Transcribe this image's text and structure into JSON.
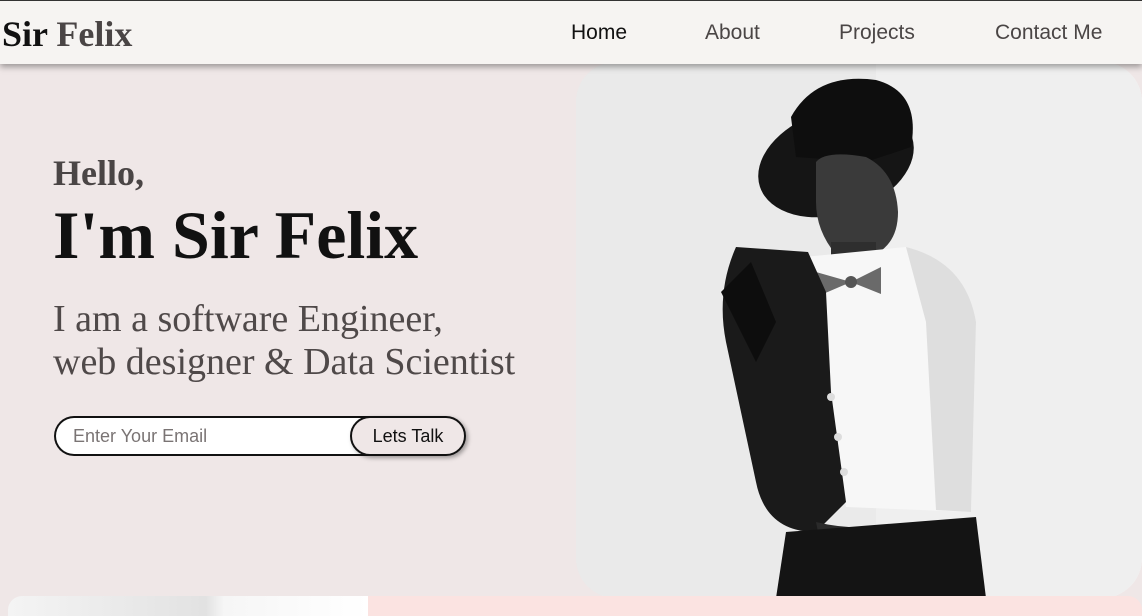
{
  "brand": {
    "first": "Sir",
    "second": "Felix"
  },
  "nav": {
    "items": [
      {
        "label": "Home",
        "active": true
      },
      {
        "label": "About",
        "active": false
      },
      {
        "label": "Projects",
        "active": false
      },
      {
        "label": "Contact Me",
        "active": false
      }
    ]
  },
  "hero": {
    "greeting": "Hello,",
    "headline": "I'm Sir Felix",
    "tagline_line1": "I am a software Engineer,",
    "tagline_line2": "web designer & Data Scientist",
    "email_placeholder": "Enter Your Email",
    "email_value": "",
    "cta_label": "Lets Talk"
  },
  "colors": {
    "background": "#efe7e7",
    "navbar": "#f6f4f2",
    "text_dark": "#111111",
    "text_muted": "#4a4545",
    "accent_pink": "#fbe3e1"
  }
}
